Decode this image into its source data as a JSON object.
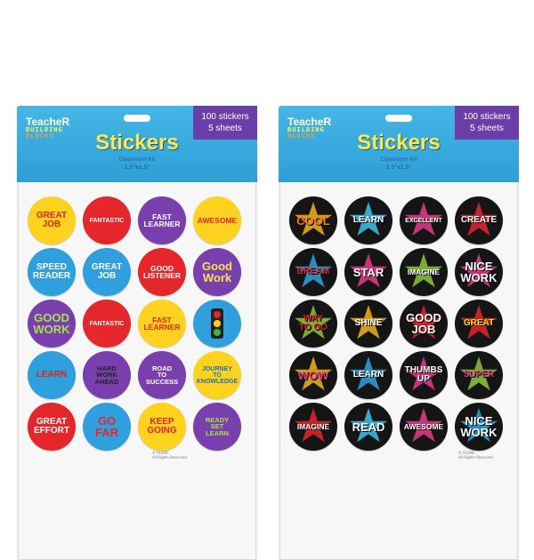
{
  "packs": [
    {
      "brand": {
        "top": "TeacheR",
        "mid": "BUILDING",
        "bot": "BLOCKS"
      },
      "count_line1": "100 stickers",
      "count_line2": "5 sheets",
      "title": "Stickers",
      "subtitle": "Classroom Kit",
      "size": "1.5\"x1.5\"",
      "copyright": "© PLSMC\nAll Rights Reserved",
      "stickers": [
        {
          "text": "GREAT\nJOB",
          "bg": "#ffd21f",
          "fg": "#e0251b"
        },
        {
          "text": "FANTASTIC",
          "bg": "#e5262b",
          "fg": "#ffffff"
        },
        {
          "text": "FAST\nLEARNER",
          "bg": "#7a3fae",
          "fg": "#ffffff"
        },
        {
          "text": "AWESOME",
          "bg": "#ffd21f",
          "fg": "#e0251b"
        },
        {
          "text": "SPEED\nREADER",
          "bg": "#2fa0dd",
          "fg": "#ffffff"
        },
        {
          "text": "GREAT\nJOB",
          "bg": "#2fa0dd",
          "fg": "#ffffff"
        },
        {
          "text": "GOOD\nLISTENER",
          "bg": "#e5262b",
          "fg": "#ffffff"
        },
        {
          "text": "Good\nWork",
          "bg": "#7a3fae",
          "fg": "#ffe14a"
        },
        {
          "text": "GOOD\nWORK",
          "bg": "#7a3fae",
          "fg": "#a6e24a"
        },
        {
          "text": "FANTASTIC",
          "bg": "#e5262b",
          "fg": "#ffffff"
        },
        {
          "text": "FAST\nLEARNER",
          "bg": "#ffd21f",
          "fg": "#e0251b"
        },
        {
          "text": "",
          "bg": "#2fa0dd",
          "fg": "#ffffff",
          "icon": "traffic-light-icon"
        },
        {
          "text": "LEARN",
          "bg": "#2fa0dd",
          "fg": "#e0251b"
        },
        {
          "text": "HARD\nWORK\nAHEAD",
          "bg": "#7a3fae",
          "fg": "#222222"
        },
        {
          "text": "ROAD\nTO\nSUCCESS",
          "bg": "#7a3fae",
          "fg": "#ffffff"
        },
        {
          "text": "JOURNEY\nTO\nKNOWLEDGE",
          "bg": "#ffd21f",
          "fg": "#1e6fb8"
        },
        {
          "text": "GREAT\nEFFORT",
          "bg": "#e5262b",
          "fg": "#ffffff"
        },
        {
          "text": "GO\nFAR",
          "bg": "#2fa0dd",
          "fg": "#e5262b"
        },
        {
          "text": "KEEP\nGOING",
          "bg": "#ffd21f",
          "fg": "#e0251b"
        },
        {
          "text": "READY\nSET\nLEARN",
          "bg": "#7a3fae",
          "fg": "#a6e24a"
        }
      ]
    },
    {
      "brand": {
        "top": "TeacheR",
        "mid": "BUILDING",
        "bot": "BLOCKS"
      },
      "count_line1": "100 stickers",
      "count_line2": "5 sheets",
      "title": "Stickers",
      "subtitle": "Classroom Kit",
      "size": "1.5\"x1.5\"",
      "copyright": "© PLSMC\nAll Rights Reserved",
      "stickers": [
        {
          "text": "COOL",
          "star": "#f2b21a",
          "fg": "#f47a1f"
        },
        {
          "text": "LEARN",
          "star": "#3ec1e8",
          "fg": "#ffffff"
        },
        {
          "text": "EXCELLENT",
          "star": "#e53a8d",
          "fg": "#ffffff"
        },
        {
          "text": "CREATE",
          "star": "#e5262b",
          "fg": "#ffffff"
        },
        {
          "text": "DREAM",
          "star": "#2fa0dd",
          "fg": "#e5262b"
        },
        {
          "text": "STAR",
          "star": "#e53a8d",
          "fg": "#ffffff"
        },
        {
          "text": "IMAGINE",
          "star": "#8cc63f",
          "fg": "#ffffff"
        },
        {
          "text": "NICE\nWORK",
          "star": "#e53a8d",
          "fg": "#ffffff"
        },
        {
          "text": "WAY\nTO GO",
          "star": "#8cc63f",
          "fg": "#e5262b"
        },
        {
          "text": "SHINE",
          "star": "#f2b21a",
          "fg": "#ffffff"
        },
        {
          "text": "GOOD\nJOB",
          "star": "#e5262b",
          "fg": "#ffffff"
        },
        {
          "text": "GREAT",
          "star": "#e5262b",
          "fg": "#f2e11a"
        },
        {
          "text": "WOW",
          "star": "#f2b21a",
          "fg": "#e53a8d"
        },
        {
          "text": "LEARN",
          "star": "#2fa0dd",
          "fg": "#ffffff"
        },
        {
          "text": "THUMBS\nUP",
          "star": "#e53a8d",
          "fg": "#ffffff"
        },
        {
          "text": "SUPER",
          "star": "#8cc63f",
          "fg": "#e53a8d"
        },
        {
          "text": "IMAGINE",
          "star": "#e5262b",
          "fg": "#ffffff"
        },
        {
          "text": "READ",
          "star": "#3ec1e8",
          "fg": "#ffffff"
        },
        {
          "text": "AWESOME",
          "star": "#e53a8d",
          "fg": "#ffffff"
        },
        {
          "text": "NICE\nWORK",
          "star": "#2fa0dd",
          "fg": "#ffffff"
        }
      ]
    }
  ]
}
